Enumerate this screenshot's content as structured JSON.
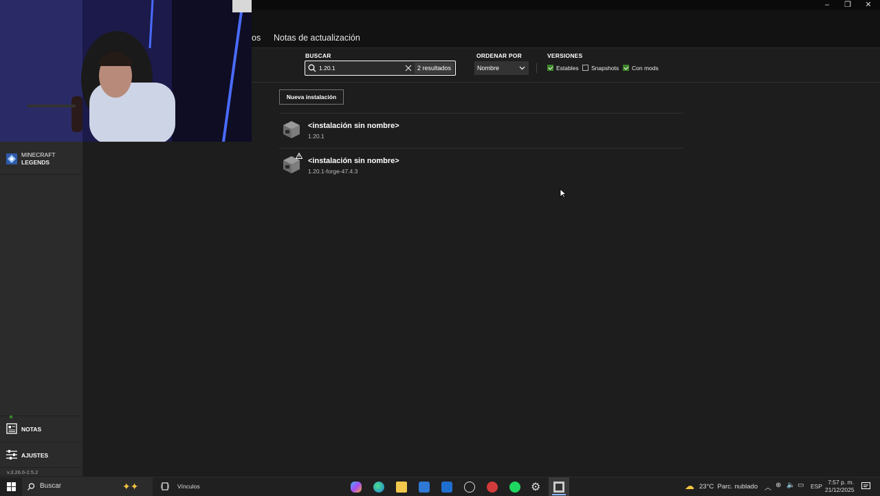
{
  "window": {
    "minimize": "–",
    "restore": "❐",
    "close": "✕"
  },
  "header": {
    "tab_partial": "os",
    "tab_patch_notes": "Notas de actualización"
  },
  "filters": {
    "search_label": "BUSCAR",
    "search_value": "1.20.1",
    "results": "2 resultados",
    "sort_label": "ORDENAR POR",
    "sort_value": "Nombre",
    "versions_label": "VERSIONES",
    "versions": [
      {
        "label": "Estables",
        "checked": true
      },
      {
        "label": "Snapshots",
        "checked": false
      },
      {
        "label": "Con mods",
        "checked": true
      }
    ]
  },
  "main": {
    "new_install_button": "Nueva instalación",
    "installations": [
      {
        "name": "<instalación sin nombre>",
        "version": "1.20.1",
        "warning": false
      },
      {
        "name": "<instalación sin nombre>",
        "version": "1.20.1-forge-47.4.3",
        "warning": true
      }
    ]
  },
  "sidebar": {
    "legends_line1": "MINECRAFT",
    "legends_line2": "LEGENDS",
    "notes": "NOTAS",
    "settings": "AJUSTES",
    "version": "v.3.26.6-2.5.2"
  },
  "taskbar": {
    "search": "Buscar",
    "links": "Vínculos",
    "weather": "23°C  Parc. nublado",
    "lang": "ESP",
    "time": "7:57 p. m.",
    "date": "21/12/2025"
  },
  "colors": {
    "accent_green": "#3c8527",
    "background": "#1d1d1d",
    "sidebar": "#2b2b2b"
  }
}
